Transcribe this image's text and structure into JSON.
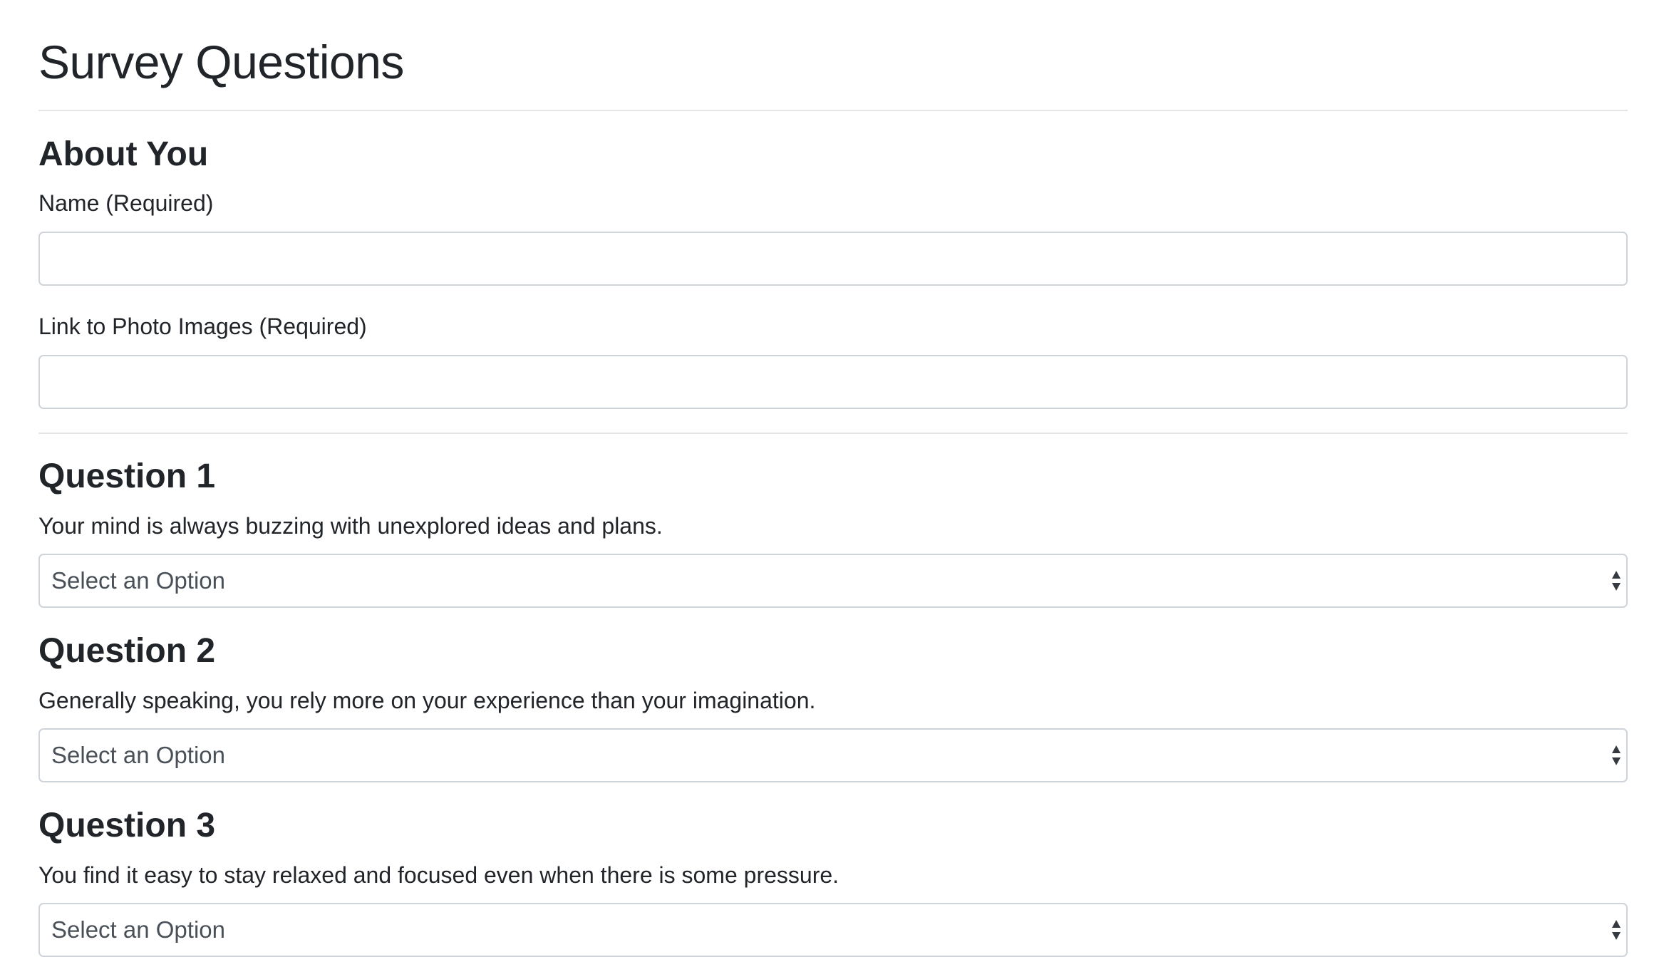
{
  "page": {
    "title": "Survey Questions"
  },
  "about": {
    "heading": "About You",
    "name_label": "Name (Required)",
    "name_value": "",
    "photo_label": "Link to Photo Images (Required)",
    "photo_value": ""
  },
  "questions": [
    {
      "heading": "Question 1",
      "text": "Your mind is always buzzing with unexplored ideas and plans.",
      "selected": "Select an Option"
    },
    {
      "heading": "Question 2",
      "text": "Generally speaking, you rely more on your experience than your imagination.",
      "selected": "Select an Option"
    },
    {
      "heading": "Question 3",
      "text": "You find it easy to stay relaxed and focused even when there is some pressure.",
      "selected": "Select an Option"
    }
  ],
  "icons": {
    "select_arrows": "up-down-caret-icon"
  },
  "colors": {
    "text": "#212529",
    "input_border": "#ced4da",
    "input_text": "#495057",
    "divider": "#e5e5e5"
  }
}
